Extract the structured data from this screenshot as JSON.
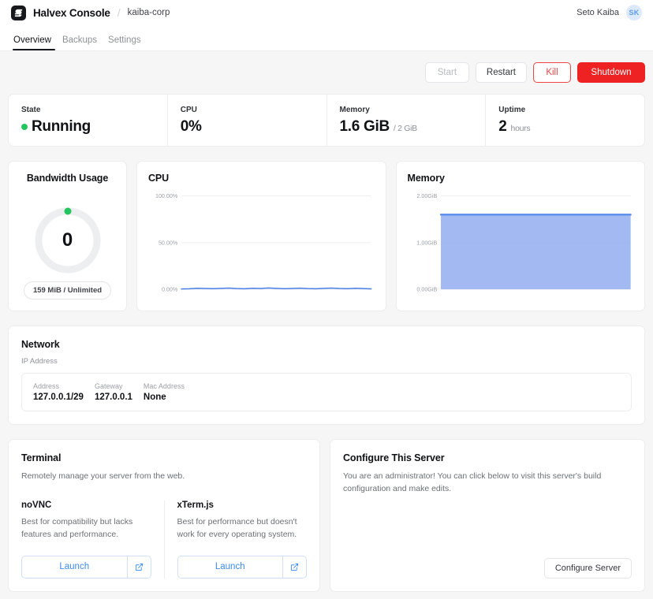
{
  "header": {
    "brand": "Halvex Console",
    "logo_icon": "halvex-logo-icon",
    "breadcrumb_separator": "/",
    "server_name": "kaiba-corp",
    "user_name": "Seto Kaiba",
    "avatar_initials": "SK"
  },
  "tabs": [
    {
      "label": "Overview",
      "active": true
    },
    {
      "label": "Backups",
      "active": false
    },
    {
      "label": "Settings",
      "active": false
    }
  ],
  "power_actions": [
    {
      "label": "Start",
      "style": "disabled"
    },
    {
      "label": "Restart",
      "style": "default"
    },
    {
      "label": "Kill",
      "style": "danger-outline"
    },
    {
      "label": "Shutdown",
      "style": "danger-solid"
    }
  ],
  "stats": [
    {
      "label": "State",
      "value": "Running",
      "sub": "",
      "indicator": "status-dot-running",
      "indicator_color": "#23c55e"
    },
    {
      "label": "CPU",
      "value": "0%",
      "sub": "",
      "indicator": ""
    },
    {
      "label": "Memory",
      "value": "1.6 GiB",
      "sub": "/ 2 GiB",
      "indicator": ""
    },
    {
      "label": "Uptime",
      "value": "2",
      "sub": "hours",
      "indicator": ""
    }
  ],
  "bandwidth": {
    "title": "Bandwidth Usage",
    "value": "0",
    "badge": "159 MiB / Unlimited",
    "gauge_percent": 0,
    "marker_color": "#23c55e",
    "track_color": "#eceef0"
  },
  "network": {
    "title": "Network",
    "subtitle": "IP Address",
    "columns": [
      "Address",
      "Gateway",
      "Mac Address"
    ],
    "row": [
      "127.0.0.1/29",
      "127.0.0.1",
      "None"
    ]
  },
  "terminal": {
    "title": "Terminal",
    "description": "Remotely manage your server from the web.",
    "options": [
      {
        "name": "noVNC",
        "description": "Best for compatibility but lacks features and performance.",
        "button_label": "Launch",
        "button_icon": "external-link-icon"
      },
      {
        "name": "xTerm.js",
        "description": "Best for performance but doesn't work for every operating system.",
        "button_label": "Launch",
        "button_icon": "external-link-icon"
      }
    ]
  },
  "configure": {
    "title": "Configure This Server",
    "description": "You are an administrator! You can click below to visit this server's build configuration and make edits.",
    "button_label": "Configure Server"
  },
  "colors": {
    "accent_blue": "#4a7fe8",
    "area_fill": "#93adf0",
    "danger": "#ee2222",
    "success": "#23c55e",
    "link": "#3d8bf2"
  },
  "chart_data": [
    {
      "type": "line",
      "title": "CPU",
      "xlabel": "",
      "ylabel": "",
      "ylim": [
        0,
        100
      ],
      "yticks": [
        0,
        50,
        100
      ],
      "ytick_labels": [
        "0.00%",
        "50.00%",
        "100.00%"
      ],
      "grid": true,
      "legend": "none",
      "line_color": "#4a7fe8",
      "series": [
        {
          "name": "CPU",
          "values": [
            0.4,
            0.6,
            1.1,
            0.9,
            0.7,
            1.0,
            1.3,
            0.8,
            0.6,
            1.1,
            0.9,
            1.4,
            1.0,
            0.7,
            0.9,
            1.2,
            0.8,
            0.6,
            1.0,
            1.3,
            0.9,
            0.7,
            1.1,
            0.8,
            0.5
          ]
        }
      ]
    },
    {
      "type": "area",
      "title": "Memory",
      "xlabel": "",
      "ylabel": "",
      "ylim": [
        0,
        2
      ],
      "yticks": [
        0,
        1,
        2
      ],
      "ytick_labels": [
        "0.00GiB",
        "1.00GiB",
        "2.00GiB"
      ],
      "grid": true,
      "legend": "none",
      "line_color": "#5b8def",
      "fill_color": "#93adf0",
      "series": [
        {
          "name": "Memory",
          "values": [
            1.6,
            1.6,
            1.6,
            1.6,
            1.6,
            1.6,
            1.6,
            1.6,
            1.6,
            1.6,
            1.6,
            1.6,
            1.6,
            1.6,
            1.6,
            1.6,
            1.6,
            1.6,
            1.6,
            1.6,
            1.6,
            1.6,
            1.6,
            1.6,
            1.6
          ]
        }
      ]
    }
  ]
}
